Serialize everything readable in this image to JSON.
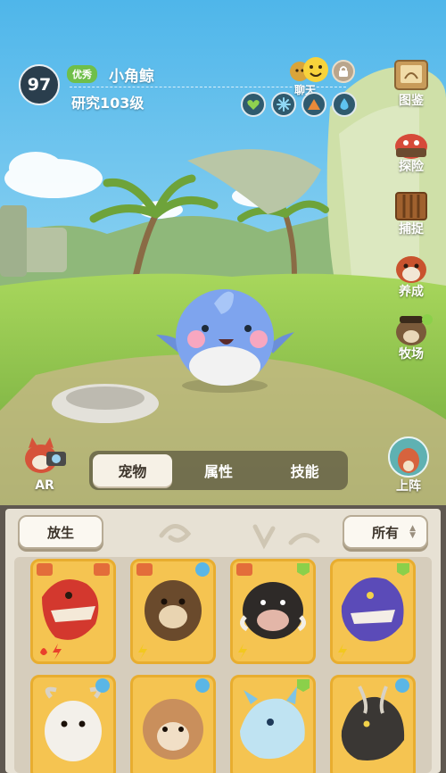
{
  "header": {
    "level": "97",
    "grade": "优秀",
    "pet_name": "小角鲸",
    "research": "研究103级",
    "chat_label": "聊天"
  },
  "attributes": [
    "heart-attr-icon",
    "snowflake-attr-icon",
    "mountain-attr-icon",
    "water-drop-attr-icon"
  ],
  "side_menu": {
    "atlas": "图鉴",
    "explore": "探险",
    "capture": "捕捉",
    "nurture": "养成",
    "ranch": "牧场"
  },
  "ar_label": "AR",
  "deploy_label": "上阵",
  "tabs": {
    "pet": "宠物",
    "stats": "属性",
    "skills": "技能",
    "active": "pet"
  },
  "panel": {
    "release_label": "放生",
    "filter_label": "所有"
  },
  "colors": {
    "card_gold": "#f5c451",
    "sky": "#6fc7ee",
    "grass": "#8ec94f",
    "grade_green": "#6fbf4a"
  }
}
